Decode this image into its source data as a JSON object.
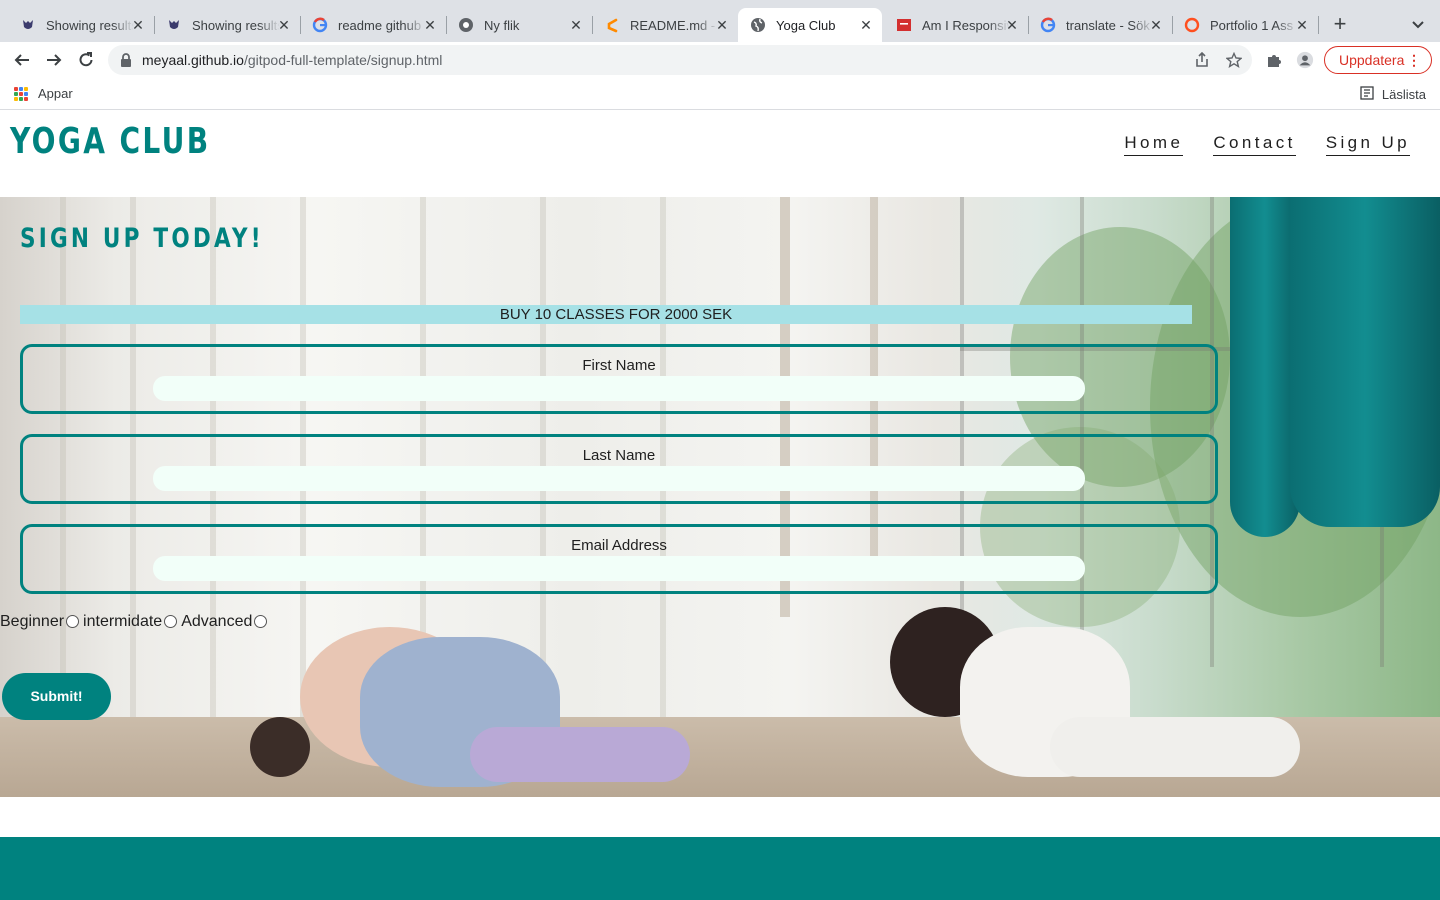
{
  "browser": {
    "tabs": [
      {
        "title": "Showing results",
        "icon": "github-octocat-icon"
      },
      {
        "title": "Showing results",
        "icon": "github-octocat-icon"
      },
      {
        "title": "readme github",
        "icon": "google-g-icon"
      },
      {
        "title": "Ny flik",
        "icon": "chrome-icon"
      },
      {
        "title": "README.md -",
        "icon": "gitpod-icon"
      },
      {
        "title": "Yoga Club",
        "icon": "globe-icon"
      },
      {
        "title": "Am I Responsive",
        "icon": "amiresponsive-icon"
      },
      {
        "title": "translate - Sök",
        "icon": "google-g-icon"
      },
      {
        "title": "Portfolio 1 Ass",
        "icon": "codeinstitute-icon"
      }
    ],
    "active_tab": 5,
    "new_tab": "+",
    "url_host": "meyaal.github.io",
    "url_path": "/gitpod-full-template/signup.html",
    "update_label": "Uppdatera",
    "bookmarks_apps": "Appar",
    "reading_list": "Läslista"
  },
  "site": {
    "brand": "YOGA CLUB",
    "nav": [
      "Home",
      "Contact",
      "Sign Up"
    ]
  },
  "signup": {
    "heading": "SIGN UP TODAY!",
    "offer": "BUY 10 CLASSES FOR 2000 SEK",
    "fields": [
      {
        "label": "First Name",
        "value": ""
      },
      {
        "label": "Last Name",
        "value": ""
      },
      {
        "label": "Email Address",
        "value": ""
      }
    ],
    "levels": [
      "Beginner",
      "intermidate",
      "Advanced"
    ],
    "submit": "Submit!"
  },
  "colors": {
    "brand_teal": "#00827f",
    "offer_bg": "#a6e1e6",
    "input_bg": "#f2fff9",
    "update_red": "#d93025"
  }
}
